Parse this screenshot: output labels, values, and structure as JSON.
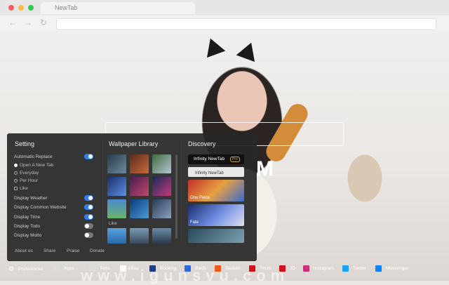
{
  "browser": {
    "tab_title": "NewTab",
    "nav": {
      "back": "←",
      "forward": "→",
      "reload": "↻"
    }
  },
  "hero": {
    "letter": "M",
    "watermark": "www.igunsvu.com"
  },
  "panel": {
    "setting": {
      "title": "Setting",
      "automatic_replace": "Automatic Replace",
      "options": [
        "Open A New Tab",
        "Everyday",
        "Per Hour",
        "Like"
      ],
      "toggles": [
        {
          "label": "Display Weather",
          "on": true
        },
        {
          "label": "Display Common Website",
          "on": true
        },
        {
          "label": "Display Time",
          "on": true
        },
        {
          "label": "Display Todo",
          "on": false
        },
        {
          "label": "Display Motto",
          "on": false
        }
      ]
    },
    "footer": [
      "About us",
      "Share",
      "Praise",
      "Donate"
    ],
    "wallpaper": {
      "title": "Wallpaper Library",
      "like_label": "Like"
    },
    "discovery": {
      "title": "Discovery",
      "brand": "Infinity NewTab",
      "pro": "Pro",
      "items": [
        "Infinity NewTab",
        "One Piece",
        "Fate"
      ]
    }
  },
  "bottombar": {
    "items": [
      "Preferences",
      "Apps",
      "Todo",
      "eBay",
      "Booking",
      "Baidu",
      "Taobao",
      "Tmall",
      "JD",
      "Instagram",
      "Twitter",
      "Messenger"
    ]
  },
  "colors": {
    "accent": "#2f80ed",
    "panel_bg": "#282828"
  }
}
